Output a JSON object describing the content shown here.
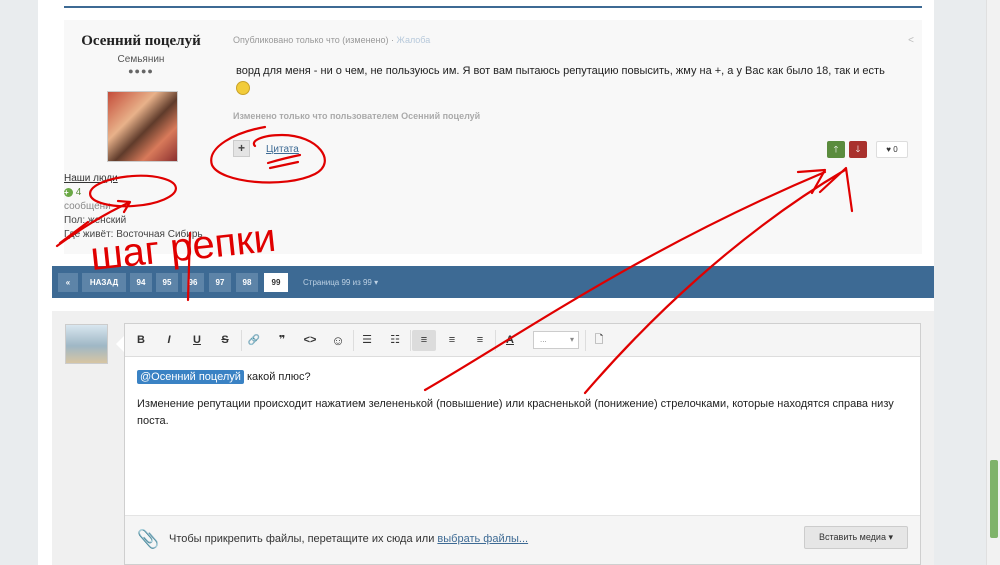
{
  "post": {
    "author_name": "Осенний поцелуй",
    "author_rank": "Семьянин",
    "author_pips": "●●●●",
    "author_group": "Наши люди",
    "reputation": "4",
    "author_posts": "сообщени",
    "author_gender": "Пол: женский",
    "author_location": "Где живёт: Восточная Сибирь",
    "meta_published": "Опубликовано только что (изменено)",
    "meta_separator": " · ",
    "meta_report": "Жалоба",
    "body_text": "ворд для меня - ни о чем, не пользуюсь им. Я вот  вам пытаюсь репутацию повысить, жму на +, а у Вас как было 18, так и есть",
    "edited_note": "Изменено только что пользователем Осенний поцелуй",
    "multiquote_label": "+",
    "quote_label": "Цитата",
    "rep_up_label": "🡑",
    "rep_down_label": "🡓",
    "like_label": "♥ 0"
  },
  "pagination": {
    "prev_icon": "«",
    "back_label": "НАЗАД",
    "pages": [
      "94",
      "95",
      "96",
      "97",
      "98",
      "99"
    ],
    "current_page": "99",
    "info": "Страница 99 из 99 ▾"
  },
  "editor": {
    "toolbar": {
      "bold": "B",
      "italic": "I",
      "underline": "U",
      "strike": "S",
      "link": "🔗",
      "quote": "❞",
      "code": "<>",
      "emoji": "☺",
      "bullets": "☰",
      "numbered": "☷",
      "align_left": "≡",
      "align_center": "≡",
      "align_right": "≡",
      "color": "A",
      "font_size": "...",
      "preview": "🗋"
    },
    "mention": "@Осенний поцелуй",
    "line1_rest": " какой плюс?",
    "line2": "Изменение репутации происходит нажатием зелененькой (повышение) или красненькой (понижение) стрелочками, которые находятся справа низу поста.",
    "attach_text": "Чтобы прикрепить файлы, перетащите их сюда или ",
    "attach_link": "выбрать файлы...",
    "insert_media": "Вставить медиа ▾"
  },
  "annotation": {
    "handwriting": "шаг репки",
    "color": "#e00000"
  },
  "colors": {
    "brand_blue": "#3d6a94",
    "rep_up": "#5b8c3e",
    "rep_down": "#a9312d"
  }
}
